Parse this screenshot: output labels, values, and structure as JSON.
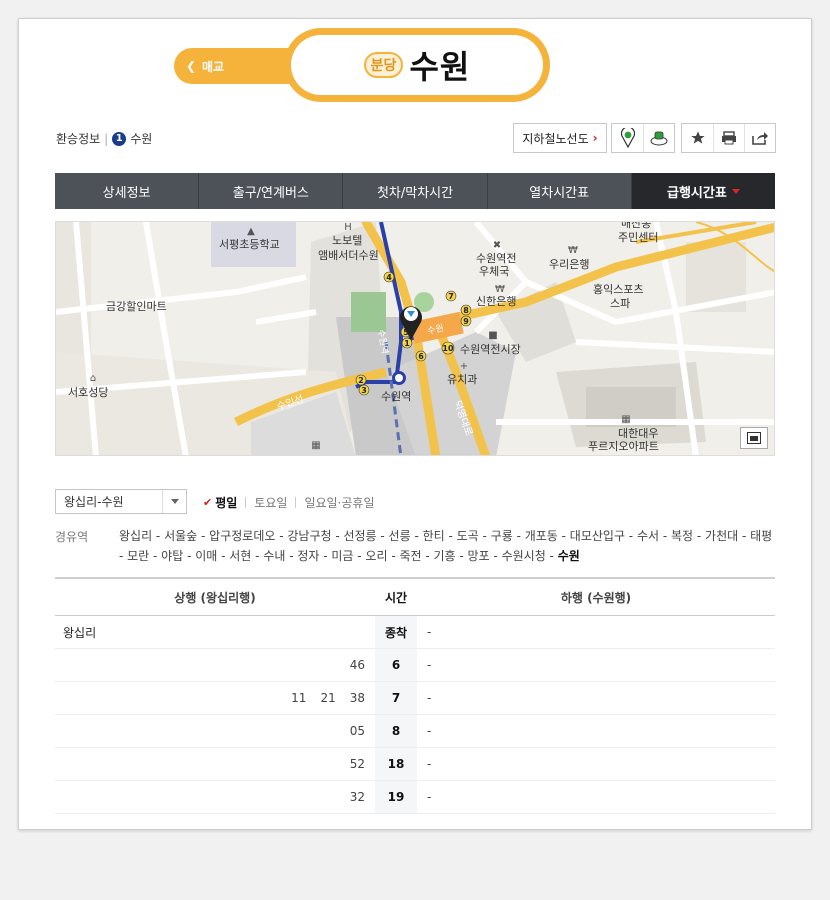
{
  "header": {
    "back_label": "매교",
    "line_badge": "분당",
    "station_name": "수원"
  },
  "transfer": {
    "label": "환승정보",
    "line_number": "1",
    "station": "수원"
  },
  "toolbar": {
    "subway_map_label": "지하철노선도",
    "icons": [
      "station-pin-icon",
      "exit-icon",
      "favorite-star-icon",
      "print-icon",
      "share-icon"
    ]
  },
  "tabs": [
    {
      "label": "상세정보"
    },
    {
      "label": "출구/연계버스"
    },
    {
      "label": "첫차/막차시간"
    },
    {
      "label": "열차시간표"
    },
    {
      "label": "급행시간표",
      "active": true
    }
  ],
  "map": {
    "labels": {
      "school": "서평초등학교",
      "hotel1": "노보텔",
      "hotel2": "앰배서더수원",
      "post1": "수원역전",
      "post2": "우체국",
      "bank1": "우리은행",
      "center1": "매산동",
      "center2": "주민센터",
      "mart": "금강할인마트",
      "bank2": "신한은행",
      "sports1": "홍익스포츠",
      "sports2": "스파",
      "market": "수원역전시장",
      "dental": "유치과",
      "church": "서호성당",
      "station": "수원역",
      "apt1": "대한대우",
      "apt2": "푸르지오아파트",
      "road1": "수인선",
      "road2": "덕영대로",
      "line_label1": "수원역",
      "line_label2": "수원"
    },
    "exit_numbers": [
      "1",
      "2",
      "3",
      "4",
      "5",
      "6",
      "7",
      "8",
      "9",
      "10"
    ],
    "colors": {
      "line": "#2b3fa8",
      "bundang": "#f5b33c",
      "rail": "#e8b83a"
    }
  },
  "route": {
    "selected": "왕십리-수원"
  },
  "daytypes": {
    "weekday": "평일",
    "saturday": "토요일",
    "holiday": "일요일·공휴일"
  },
  "via": {
    "label": "경유역",
    "stations_text": "왕십리 - 서울숲 - 압구정로데오 - 강남구청 - 선정릉 - 선릉 - 한티 - 도곡 - 구룡 - 개포동 - 대모산입구 - 수서 - 복정 - 가천대 - 태평 - 모란 - 야탑 - 이매 - 서현 - 수내 - 정자 - 미금 - 오리 - 죽전 - 기흥 - 망포 - 수원시청 - ",
    "last": "수원"
  },
  "timetable": {
    "head_up": "상행 (왕십리행)",
    "head_time": "시간",
    "head_down": "하행 (수원행)",
    "origin_label": "왕십리",
    "origin_time": "종착",
    "origin_down": "-",
    "rows": [
      {
        "hour": "6",
        "up": [
          "46"
        ],
        "down": "-"
      },
      {
        "hour": "7",
        "up": [
          "11",
          "21",
          "38"
        ],
        "down": "-"
      },
      {
        "hour": "8",
        "up": [
          "05"
        ],
        "down": "-"
      },
      {
        "hour": "18",
        "up": [
          "52"
        ],
        "down": "-"
      },
      {
        "hour": "19",
        "up": [
          "32"
        ],
        "down": "-"
      }
    ]
  }
}
